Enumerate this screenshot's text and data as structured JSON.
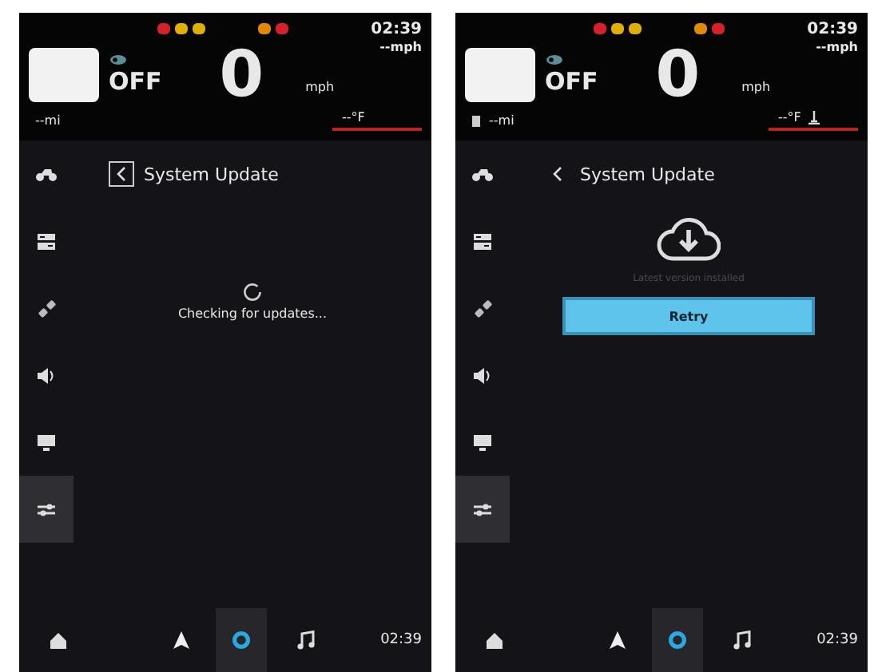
{
  "screens": [
    {
      "header": {
        "warning_lights": [
          {
            "color": "#d8202a"
          },
          {
            "color": "#e0b000"
          },
          {
            "color": "#e0b000"
          },
          {
            "color": "#e08a00"
          },
          {
            "color": "#d8202a"
          }
        ],
        "time": "02:39",
        "speed_limit": "--mph",
        "gear": "OFF",
        "speed": "0",
        "speed_unit": "mph",
        "range": "--mi",
        "temperature": "--°F",
        "fuel_icon": false,
        "thermometer_icon": false
      },
      "sidebar": [
        {
          "selected": false
        },
        {
          "selected": false
        },
        {
          "selected": false
        },
        {
          "selected": false
        },
        {
          "selected": false
        },
        {
          "selected": true
        }
      ],
      "title": "System Update",
      "back_focused": true,
      "content": {
        "kind": "checking",
        "message": "Checking for updates..."
      },
      "bottom_nav": [
        {
          "selected": false
        },
        {
          "selected": false
        },
        {
          "selected": true
        },
        {
          "selected": false
        }
      ],
      "clock": "02:39"
    },
    {
      "header": {
        "warning_lights": [
          {
            "color": "#d8202a"
          },
          {
            "color": "#e0b000"
          },
          {
            "color": "#e0b000"
          },
          {
            "color": "#e08a00"
          },
          {
            "color": "#d8202a"
          }
        ],
        "time": "02:39",
        "speed_limit": "--mph",
        "gear": "OFF",
        "speed": "0",
        "speed_unit": "mph",
        "range": "--mi",
        "temperature": "--°F",
        "fuel_icon": true,
        "thermometer_icon": true
      },
      "sidebar": [
        {
          "selected": false
        },
        {
          "selected": false
        },
        {
          "selected": false
        },
        {
          "selected": false
        },
        {
          "selected": false
        },
        {
          "selected": true
        }
      ],
      "title": "System Update",
      "back_focused": false,
      "content": {
        "kind": "result",
        "message": "Latest version installed",
        "button": "Retry"
      },
      "bottom_nav": [
        {
          "selected": false
        },
        {
          "selected": false
        },
        {
          "selected": true
        },
        {
          "selected": false
        }
      ],
      "clock": "02:39"
    }
  ]
}
